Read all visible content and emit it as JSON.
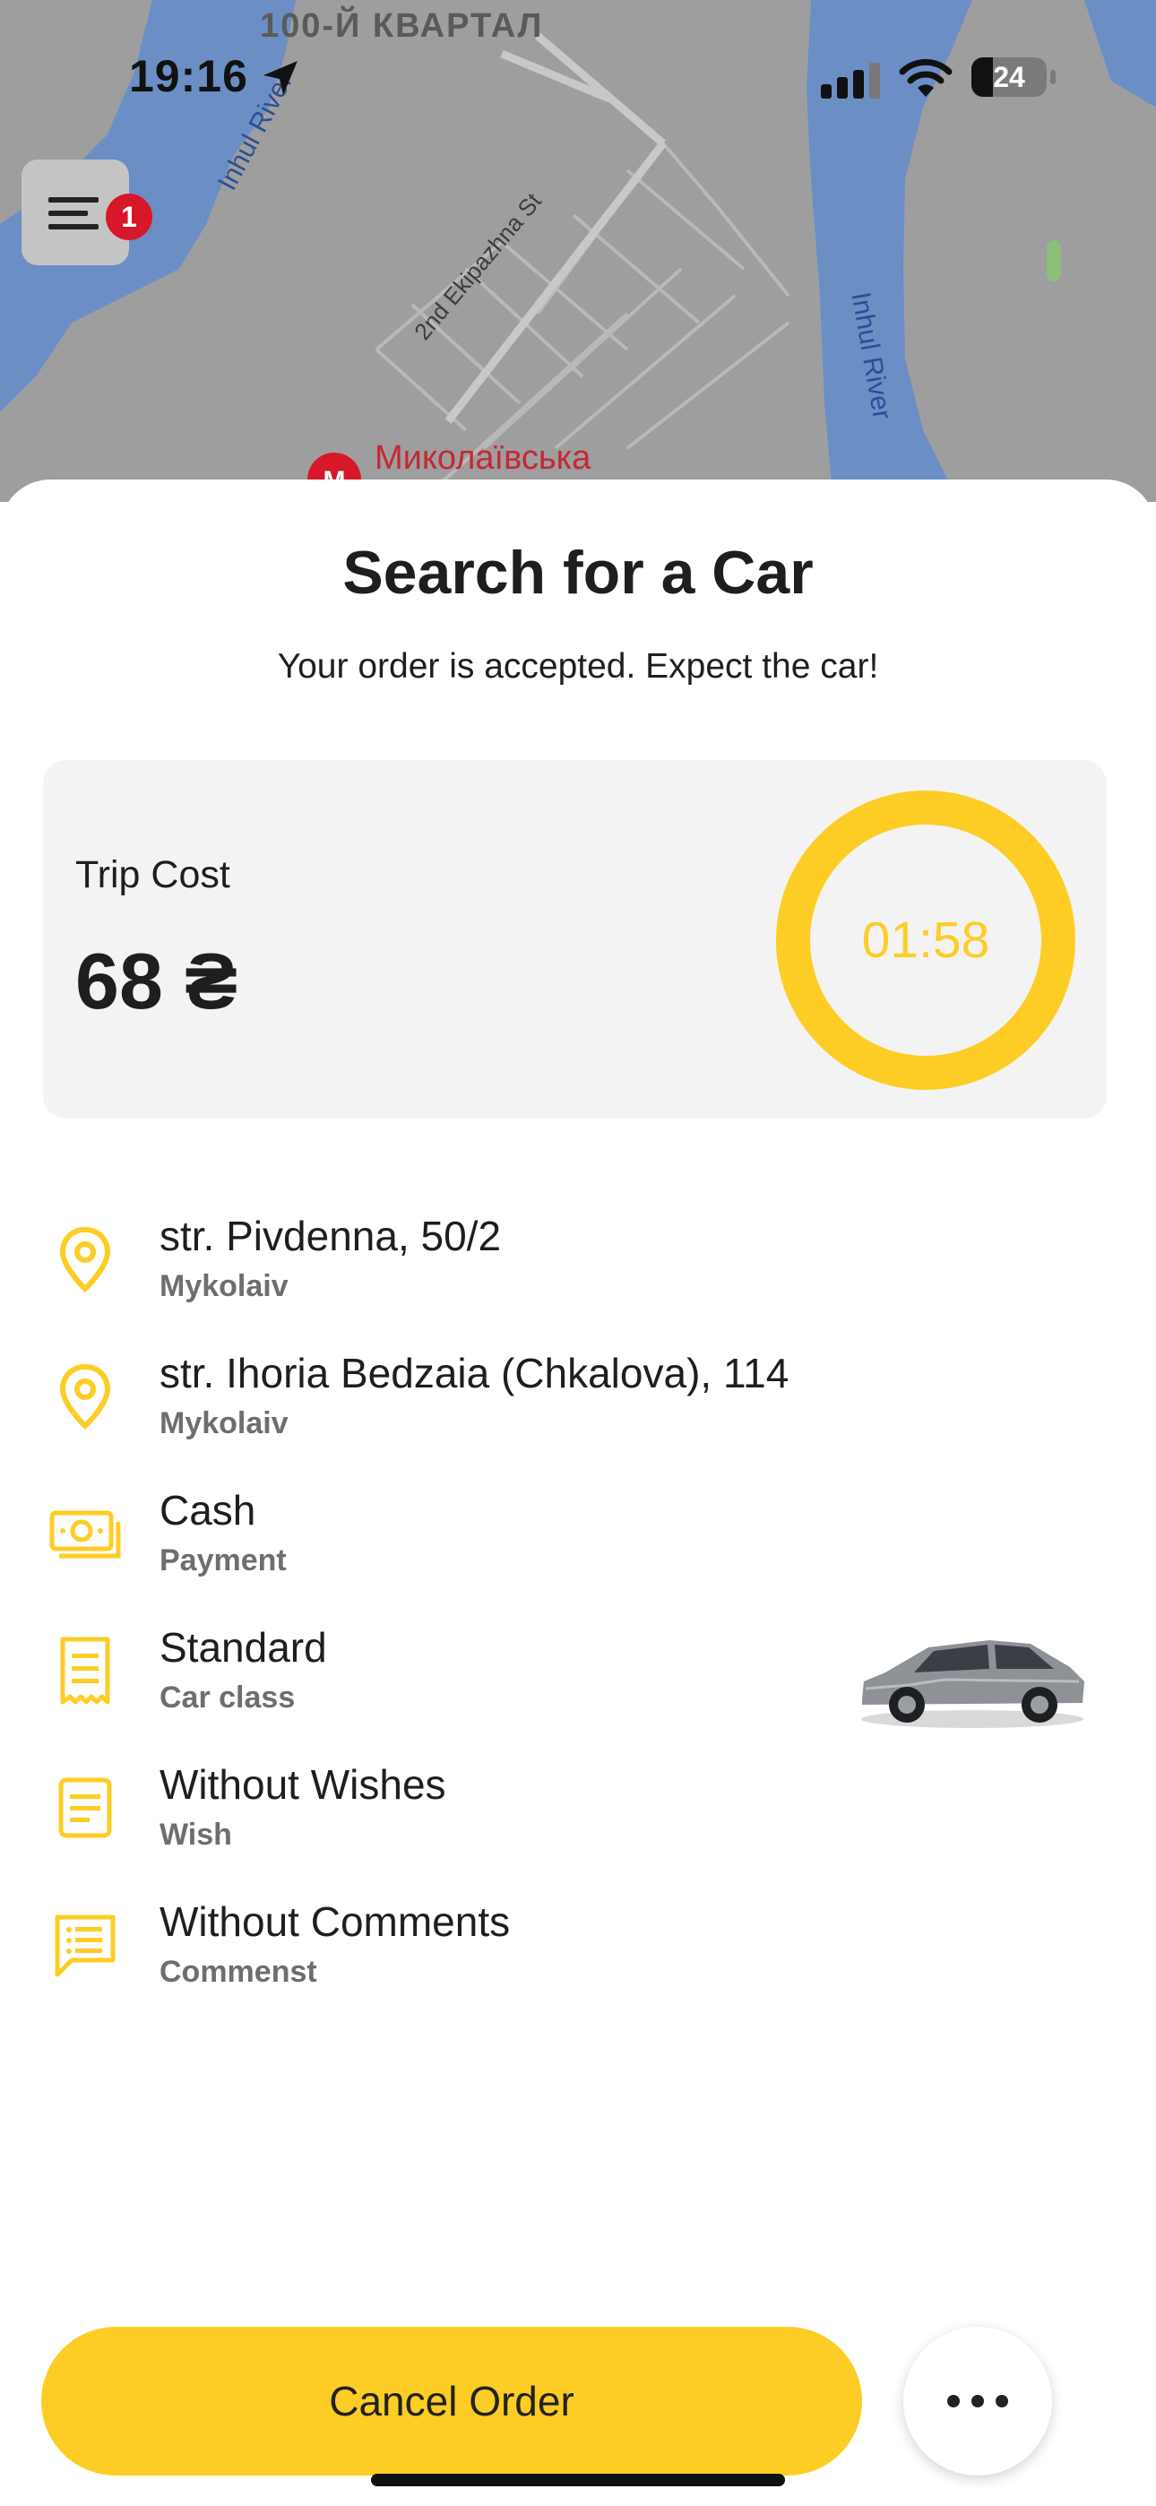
{
  "status_bar": {
    "time": "19:16",
    "battery_level": "24",
    "icons": [
      "location-arrow-icon",
      "cellular-signal-icon",
      "wifi-icon",
      "battery-icon"
    ]
  },
  "map": {
    "district_label": "100-Й КВАРТАЛ",
    "river_label_left": "Inhul River",
    "river_label_right": "Inhul River",
    "street_label": "2nd Ekipazhna St",
    "metro_label": "Миколаївська"
  },
  "menu": {
    "icon": "hamburger-menu-icon",
    "badge_count": "1"
  },
  "sheet": {
    "title": "Search for a Car",
    "subtitle": "Your order is accepted. Expect the car!"
  },
  "cost": {
    "label": "Trip Cost",
    "value": "68 ₴",
    "timer": "01:58",
    "accent_color": "#fdcd25"
  },
  "details": [
    {
      "icon": "map-pin-icon",
      "primary": "str. Pivdenna, 50/2",
      "secondary": "Mykolaiv"
    },
    {
      "icon": "map-pin-icon",
      "primary": "str. Ihoria Bedzaia (Chkalova), 114",
      "secondary": "Mykolaiv"
    },
    {
      "icon": "cash-icon",
      "primary": "Cash",
      "secondary": "Payment"
    },
    {
      "icon": "receipt-icon",
      "primary": "Standard",
      "secondary": "Car class"
    },
    {
      "icon": "document-icon",
      "primary": "Without Wishes",
      "secondary": "Wish"
    },
    {
      "icon": "comment-icon",
      "primary": "Without Comments",
      "secondary": "Commenst"
    }
  ],
  "actions": {
    "cancel_label": "Cancel Order",
    "more_icon": "more-horizontal-icon"
  }
}
